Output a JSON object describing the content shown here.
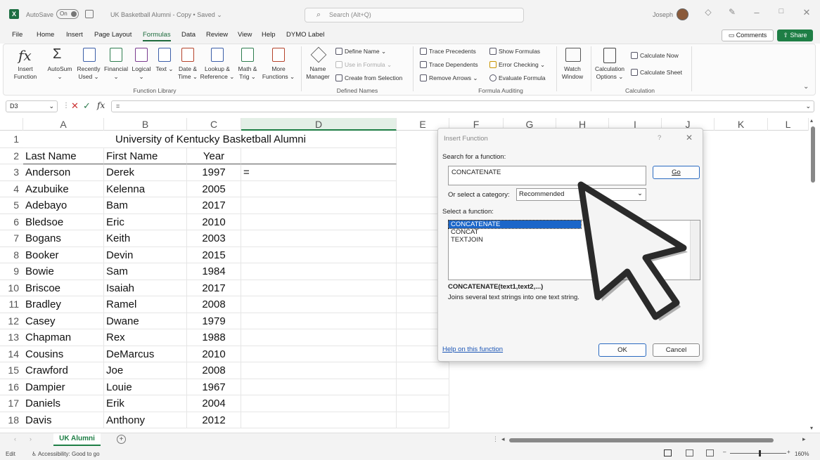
{
  "titlebar": {
    "autosave_label": "AutoSave",
    "autosave_state": "On",
    "doc_title": "UK Basketball Alumni - Copy • Saved ⌄",
    "search_placeholder": "Search (Alt+Q)",
    "user": "Joseph"
  },
  "menu": {
    "items": [
      "File",
      "Home",
      "Insert",
      "Page Layout",
      "Formulas",
      "Data",
      "Review",
      "View",
      "Help",
      "DYMO Label"
    ],
    "active": "Formulas",
    "comments_label": "Comments",
    "share_label": "Share"
  },
  "ribbon": {
    "insert_function": "Insert Function",
    "library_buttons": [
      "AutoSum ⌄",
      "Recently Used ⌄",
      "Financial ⌄",
      "Logical ⌄",
      "Text ⌄",
      "Date & Time ⌄",
      "Lookup & Reference ⌄",
      "Math & Trig ⌄",
      "More Functions ⌄"
    ],
    "function_library_group": "Function Library",
    "name_manager": "Name Manager",
    "define_name": "Define Name ⌄",
    "use_in_formula": "Use in Formula ⌄",
    "create_from_selection": "Create from Selection",
    "defined_names_group": "Defined Names",
    "trace_precedents": "Trace Precedents",
    "trace_dependents": "Trace Dependents",
    "remove_arrows": "Remove Arrows ⌄",
    "show_formulas": "Show Formulas",
    "error_checking": "Error Checking ⌄",
    "evaluate_formula": "Evaluate Formula",
    "watch_window": "Watch Window",
    "formula_auditing_group": "Formula Auditing",
    "calculation_options": "Calculation Options ⌄",
    "calculate_now": "Calculate Now",
    "calculate_sheet": "Calculate Sheet",
    "calculation_group": "Calculation"
  },
  "formula_bar": {
    "name_box": "D3",
    "fx": "fx",
    "content": "="
  },
  "sheet": {
    "columns": [
      "A",
      "B",
      "C",
      "D",
      "E",
      "F",
      "G",
      "H",
      "I",
      "J",
      "K",
      "L"
    ],
    "title": "University of Kentucky Basketball Alumni",
    "headers": [
      "Last Name",
      "First Name",
      "Year"
    ],
    "active_cell_value": "=",
    "rows": [
      [
        "Anderson",
        "Derek",
        "1997"
      ],
      [
        "Azubuike",
        "Kelenna",
        "2005"
      ],
      [
        "Adebayo",
        "Bam",
        "2017"
      ],
      [
        "Bledsoe",
        "Eric",
        "2010"
      ],
      [
        "Bogans",
        "Keith",
        "2003"
      ],
      [
        "Booker",
        "Devin",
        "2015"
      ],
      [
        "Bowie",
        "Sam",
        "1984"
      ],
      [
        "Briscoe",
        "Isaiah",
        "2017"
      ],
      [
        "Bradley",
        "Ramel",
        "2008"
      ],
      [
        "Casey",
        "Dwane",
        "1979"
      ],
      [
        "Chapman",
        "Rex",
        "1988"
      ],
      [
        "Cousins",
        "DeMarcus",
        "2010"
      ],
      [
        "Crawford",
        "Joe",
        "2008"
      ],
      [
        "Dampier",
        "Louie",
        "1967"
      ],
      [
        "Daniels",
        "Erik",
        "2004"
      ],
      [
        "Davis",
        "Anthony",
        "2012"
      ]
    ]
  },
  "dialog": {
    "title": "Insert Function",
    "help_glyph": "?",
    "search_label": "Search for a function:",
    "search_value": "CONCATENATE",
    "go_label": "Go",
    "category_label": "Or select a category:",
    "category_value": "Recommended",
    "select_label": "Select a function:",
    "functions": [
      "CONCATENATE",
      "CONCAT",
      "TEXTJOIN"
    ],
    "selected_function": "CONCATENATE",
    "signature": "CONCATENATE(text1,text2,...)",
    "description": "Joins several text strings into one text string.",
    "help_link": "Help on this function",
    "ok_label": "OK",
    "cancel_label": "Cancel"
  },
  "tabs": {
    "sheet_name": "UK Alumni"
  },
  "status": {
    "mode": "Edit",
    "accessibility": "Accessibility: Good to go",
    "zoom": "160%"
  },
  "colors": {
    "excel_green": "#1e7e45",
    "selection_blue": "#1b66c9"
  }
}
